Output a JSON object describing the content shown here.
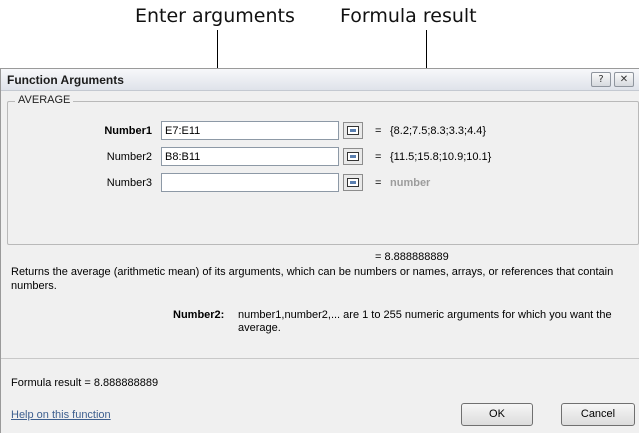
{
  "callouts": {
    "enter_arguments": "Enter arguments",
    "formula_result": "Formula result"
  },
  "dialog": {
    "title": "Function Arguments",
    "help_glyph": "?",
    "close_glyph": "✕",
    "function_name": "AVERAGE",
    "arguments": [
      {
        "label": "Number1",
        "value": "E7:E11",
        "result": "{8.2;7.5;8.3;3.3;4.4}",
        "bold": true
      },
      {
        "label": "Number2",
        "value": "B8:B11",
        "result": "{11.5;15.8;10.9;10.1}",
        "bold": false
      },
      {
        "label": "Number3",
        "value": "",
        "result": "number",
        "bold": false
      }
    ],
    "equals": "=",
    "function_result": "= 8.888888889",
    "description": "Returns the average (arithmetic mean) of its arguments, which can be numbers or names, arrays, or references that contain numbers.",
    "arg_desc_label": "Number2:",
    "arg_desc_text": "number1,number2,... are 1 to 255 numeric arguments for which you want the average.",
    "formula_result_line": "Formula result =   8.888888889",
    "help_link": "Help on this function",
    "ok_label": "OK",
    "cancel_label": "Cancel"
  }
}
